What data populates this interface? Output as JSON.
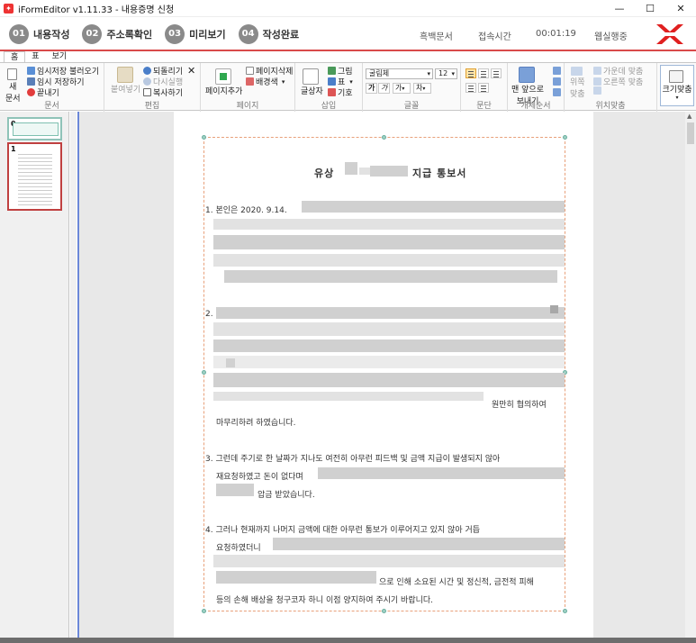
{
  "window": {
    "title": "iFormEditor v1.11.33 - 내용증명 신청",
    "minimize": "—",
    "maximize": "☐",
    "close": "✕"
  },
  "steps": [
    {
      "num": "01",
      "label": "내용작성"
    },
    {
      "num": "02",
      "label": "주소록확인"
    },
    {
      "num": "03",
      "label": "미리보기"
    },
    {
      "num": "04",
      "label": "작성완료"
    }
  ],
  "status": {
    "mode": "흑백문서",
    "time_label": "접속시간",
    "time_value": "00:01:19",
    "user": "웹실행중"
  },
  "ribbon_tabs": [
    "홈",
    "표",
    "보기"
  ],
  "ribbon": {
    "doc": {
      "new_line1": "새",
      "new_line2": "문서",
      "load_temp": "임시저장 불러오기",
      "save_temp": "임시 저장하기",
      "exit": "끝내기",
      "group": "문서"
    },
    "edit": {
      "paste": "붙여넣기",
      "undo": "되돌리기",
      "redo": "다시실행",
      "copy": "복사하기",
      "cut": "✕",
      "group": "편집"
    },
    "page": {
      "add": "페이지추가",
      "delete": "페이지삭제",
      "background": "배경색",
      "group": "페이지"
    },
    "insert": {
      "textbox": "글상자",
      "image": "그림",
      "table": "표",
      "symbol": "기호",
      "group": "삽입"
    },
    "font": {
      "face": "굴림체",
      "size": "12",
      "bold": "가",
      "italic": "가",
      "color": "가",
      "highlight": "차",
      "group": "글꼴"
    },
    "para": {
      "group": "문단"
    },
    "object_order": {
      "front_line1": "맨 앞으로",
      "front_line2": "보내기",
      "group": "개체순서"
    },
    "align": {
      "top_line1": "위쪽",
      "top_line2": "맞춤",
      "center": "가운데 맞춤",
      "right": "오른쪽 맞춤",
      "group": "위치맞춤"
    },
    "fit": {
      "label": "크기맞춤"
    }
  },
  "thumbnails": [
    "0",
    "1"
  ],
  "document": {
    "title_left": "유상",
    "title_right": "지급 통보서",
    "p1_start": "1. 본인은 2020. 9.14.",
    "p2_start": "2.",
    "p2_tail1": "원만히  협의하여",
    "p2_tail2": "마무리하려 하였습니다.",
    "p3_line1": "3. 그런데 주기로 한 날짜가 지나도 여전히 아무런 피드백 및 금액 지급이 발생되지 않아",
    "p3_line2": "재요청하였고  돈이  없다며",
    "p3_line3": "압금 받았습니다.",
    "p4_line1": "4. 그러나 현재까지 나머지 금액에 대한 아무런 통보가 이루어지고 있지 않아 거듭",
    "p4_line2": "요청하였더니",
    "p4_line3": "으로 인해 소요된 시간 및 정신적, 금전적 피해",
    "p4_line4": "등의 손해 배상을 청구코자 하니 이점 양지하여 주시기 바랍니다."
  }
}
